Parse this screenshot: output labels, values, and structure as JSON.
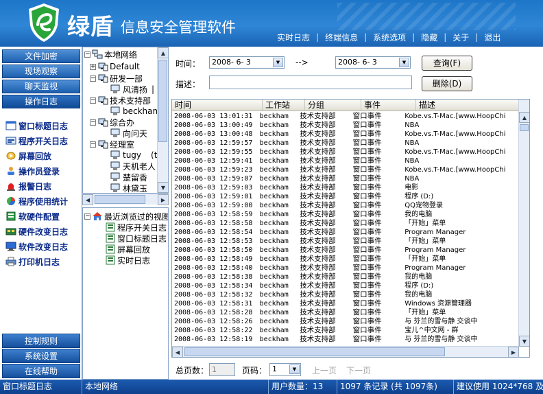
{
  "header": {
    "app_name": "绿盾",
    "app_subtitle": "信息安全管理软件",
    "menu": [
      "实时日志",
      "终端信息",
      "系统选项",
      "隐藏",
      "关于",
      "退出"
    ]
  },
  "leftnav": {
    "top_buttons": [
      "文件加密",
      "现场观察",
      "聊天监视",
      "操作日志"
    ],
    "items": [
      {
        "label": "窗口标题日志",
        "icon": "window-icon"
      },
      {
        "label": "程序开关日志",
        "icon": "program-icon"
      },
      {
        "label": "屏幕回放",
        "icon": "replay-icon"
      },
      {
        "label": "操作员登录",
        "icon": "operator-icon"
      },
      {
        "label": "报警日志",
        "icon": "alarm-icon"
      },
      {
        "label": "程序使用统计",
        "icon": "stats-icon"
      },
      {
        "label": "软硬件配置",
        "icon": "config-icon"
      },
      {
        "label": "硬件改变日志",
        "icon": "hardware-icon"
      },
      {
        "label": "软件改变日志",
        "icon": "software-icon"
      },
      {
        "label": "打印机日志",
        "icon": "printer-icon"
      }
    ],
    "bottom_buttons": [
      "控制规则",
      "系统设置",
      "在线帮助"
    ]
  },
  "tree": {
    "nodes": [
      {
        "label": "本地网络",
        "level": 0
      },
      {
        "label": "Default",
        "level": 1
      },
      {
        "label": "研发一部",
        "level": 1
      },
      {
        "label": "风清扬",
        "level": 2
      },
      {
        "label": "技术支持部",
        "level": 1
      },
      {
        "label": "beckham",
        "level": 2
      },
      {
        "label": "综合办",
        "level": 1
      },
      {
        "label": "向问天",
        "level": 2
      },
      {
        "label": "经理室",
        "level": 1
      },
      {
        "label": "tugy",
        "level": 2
      },
      {
        "label": "天机老人",
        "level": 2
      },
      {
        "label": "楚留香",
        "level": 2
      },
      {
        "label": "林黛玉",
        "level": 2
      }
    ],
    "extra_tags": {
      "tugy": "(tu",
      "风清扬": "|"
    },
    "recent": {
      "title": "最近浏览过的视图",
      "items": [
        "程序开关日志",
        "窗口标题日志",
        "屏幕回放",
        "实时日志"
      ]
    }
  },
  "filter": {
    "time_label": "时间：",
    "from_date": "2008- 6- 3",
    "arrow": "-->",
    "to_date": "2008- 6- 3",
    "desc_label": "描述：",
    "desc_value": "",
    "query_button": "查询(F)",
    "delete_button": "删除(D)"
  },
  "table": {
    "columns": [
      "时间",
      "工作站",
      "分组",
      "事件",
      "描述"
    ],
    "rows": [
      [
        "2008-06-03 13:01:31",
        "beckham",
        "技术支持部",
        "窗口事件",
        "Kobe.vs.T-Mac.[www.HoopChi"
      ],
      [
        "2008-06-03 13:00:49",
        "beckham",
        "技术支持部",
        "窗口事件",
        "NBA"
      ],
      [
        "2008-06-03 13:00:48",
        "beckham",
        "技术支持部",
        "窗口事件",
        "Kobe.vs.T-Mac.[www.HoopChi"
      ],
      [
        "2008-06-03 12:59:57",
        "beckham",
        "技术支持部",
        "窗口事件",
        "NBA"
      ],
      [
        "2008-06-03 12:59:55",
        "beckham",
        "技术支持部",
        "窗口事件",
        "Kobe.vs.T-Mac.[www.HoopChi"
      ],
      [
        "2008-06-03 12:59:41",
        "beckham",
        "技术支持部",
        "窗口事件",
        "NBA"
      ],
      [
        "2008-06-03 12:59:23",
        "beckham",
        "技术支持部",
        "窗口事件",
        "Kobe.vs.T-Mac.[www.HoopChi"
      ],
      [
        "2008-06-03 12:59:07",
        "beckham",
        "技术支持部",
        "窗口事件",
        "NBA"
      ],
      [
        "2008-06-03 12:59:03",
        "beckham",
        "技术支持部",
        "窗口事件",
        "电影"
      ],
      [
        "2008-06-03 12:59:01",
        "beckham",
        "技术支持部",
        "窗口事件",
        "程序 (D:)"
      ],
      [
        "2008-06-03 12:59:00",
        "beckham",
        "技术支持部",
        "窗口事件",
        "QQ宠物登录"
      ],
      [
        "2008-06-03 12:58:59",
        "beckham",
        "技术支持部",
        "窗口事件",
        "我的电脑"
      ],
      [
        "2008-06-03 12:58:58",
        "beckham",
        "技术支持部",
        "窗口事件",
        "「开始」菜单"
      ],
      [
        "2008-06-03 12:58:54",
        "beckham",
        "技术支持部",
        "窗口事件",
        "Program Manager"
      ],
      [
        "2008-06-03 12:58:53",
        "beckham",
        "技术支持部",
        "窗口事件",
        "「开始」菜单"
      ],
      [
        "2008-06-03 12:58:50",
        "beckham",
        "技术支持部",
        "窗口事件",
        "Program Manager"
      ],
      [
        "2008-06-03 12:58:49",
        "beckham",
        "技术支持部",
        "窗口事件",
        "「开始」菜单"
      ],
      [
        "2008-06-03 12:58:40",
        "beckham",
        "技术支持部",
        "窗口事件",
        "Program Manager"
      ],
      [
        "2008-06-03 12:58:38",
        "beckham",
        "技术支持部",
        "窗口事件",
        "我的电脑"
      ],
      [
        "2008-06-03 12:58:34",
        "beckham",
        "技术支持部",
        "窗口事件",
        "程序 (D:)"
      ],
      [
        "2008-06-03 12:58:32",
        "beckham",
        "技术支持部",
        "窗口事件",
        "我的电脑"
      ],
      [
        "2008-06-03 12:58:31",
        "beckham",
        "技术支持部",
        "窗口事件",
        "Windows 资源管理器"
      ],
      [
        "2008-06-03 12:58:28",
        "beckham",
        "技术支持部",
        "窗口事件",
        "「开始」菜单"
      ],
      [
        "2008-06-03 12:58:26",
        "beckham",
        "技术支持部",
        "窗口事件",
        "与 芬兰的雪与静 交谈中"
      ],
      [
        "2008-06-03 12:58:22",
        "beckham",
        "技术支持部",
        "窗口事件",
        "宝儿^中文网 - 群"
      ],
      [
        "2008-06-03 12:58:19",
        "beckham",
        "技术支持部",
        "窗口事件",
        "与 芬兰的雪与静 交谈中"
      ]
    ]
  },
  "pager": {
    "total_label": "总页数：",
    "total_value": "1",
    "page_label": "页码：",
    "page_value": "1",
    "prev": "上一页",
    "next": "下一页"
  },
  "status": {
    "view": "窗口标题日志",
    "scope": "本地网络",
    "users": "用户数量：13",
    "records": "1097 条记录 (共 1097条)",
    "hint": "建议使用 1024*768 及更高分辨率"
  },
  "colors": {
    "header_blue": "#2f86d6",
    "nav_text": "#0a2a8a",
    "logo_green": "#2aa53a"
  }
}
